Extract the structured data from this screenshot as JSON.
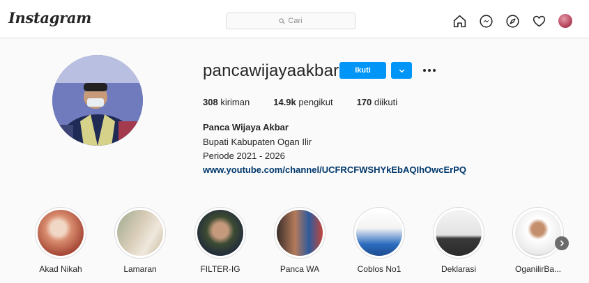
{
  "header": {
    "logo": "Instagram",
    "search_placeholder": "Cari",
    "nav_icons": [
      "home-icon",
      "messenger-icon",
      "explore-icon",
      "heart-icon",
      "profile-avatar"
    ]
  },
  "profile": {
    "username": "pancawijayaakbar",
    "follow_label": "Ikuti",
    "stats": [
      {
        "count": "308",
        "label": "kiriman"
      },
      {
        "count": "14.9k",
        "label": "pengikut"
      },
      {
        "count": "170",
        "label": "diikuti"
      }
    ],
    "full_name": "Panca Wijaya Akbar",
    "bio_lines": [
      "Bupati Kabupaten Ogan Ilir",
      "Periode 2021 - 2026"
    ],
    "link": "www.youtube.com/channel/UCFRCFWSHYkEbAQIhOwcErPQ"
  },
  "highlights": [
    {
      "label": "Akad Nikah"
    },
    {
      "label": "Lamaran"
    },
    {
      "label": "FILTER-IG"
    },
    {
      "label": "Panca WA"
    },
    {
      "label": "Coblos No1"
    },
    {
      "label": "Deklarasi"
    },
    {
      "label": "OganilirBa..."
    }
  ],
  "colors": {
    "accent": "#0095f6",
    "link": "#00376b",
    "text": "#262626",
    "muted": "#8e8e8e",
    "border": "#dbdbdb",
    "background": "#fafafa"
  }
}
